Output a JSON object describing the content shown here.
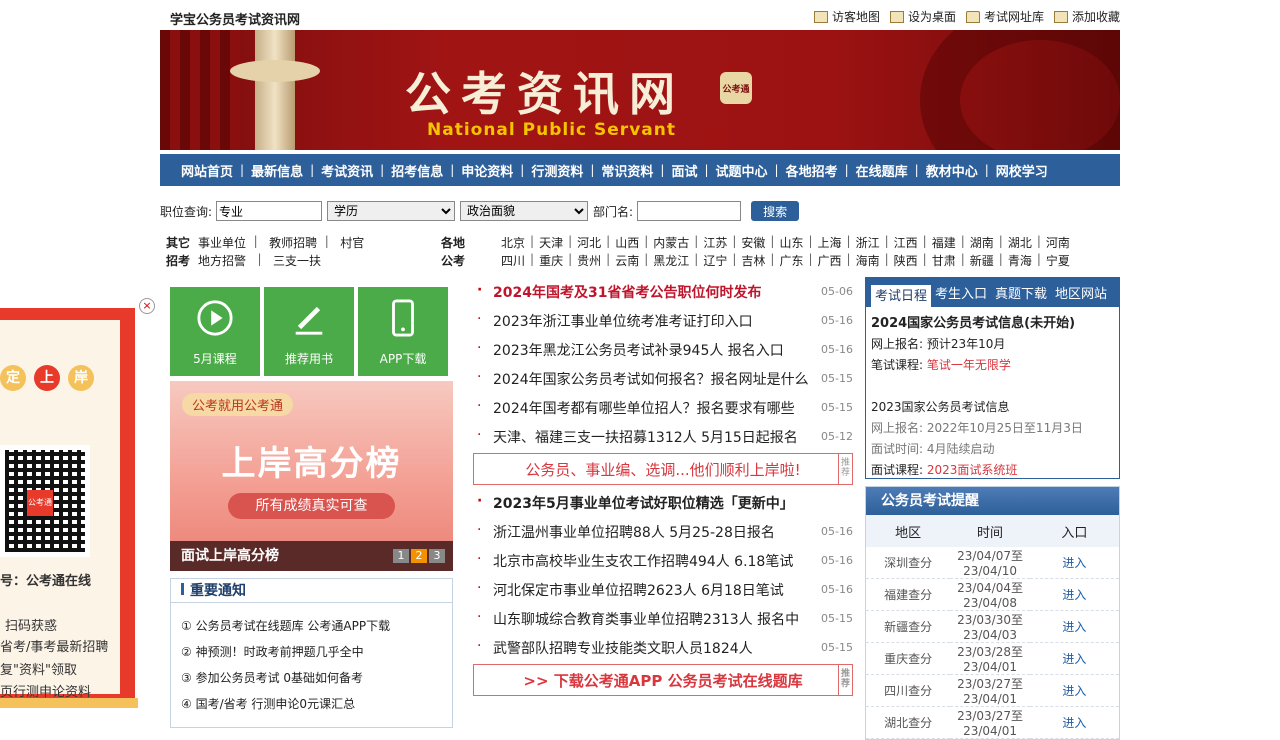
{
  "top": {
    "site_name": "学宝公务员考试资讯网",
    "links": [
      "访客地图",
      "设为桌面",
      "考试网址库",
      "添加收藏"
    ]
  },
  "banner": {
    "title": "公考资讯网",
    "badge": "公考通",
    "subtitle": "National Public Servant"
  },
  "nav": [
    "网站首页",
    "最新信息",
    "考试资讯",
    "招考信息",
    "申论资料",
    "行测资料",
    "常识资料",
    "面试",
    "试题中心",
    "各地招考",
    "在线题库",
    "教材中心",
    "网校学习"
  ],
  "search": {
    "label": "职位查询:",
    "major_value": "专业",
    "education": "学历",
    "politics": "政治面貌",
    "dept_label": "部门名:",
    "button": "搜索"
  },
  "regions": {
    "other_label_1": "其它",
    "other_label_2": "招考",
    "other_row1": [
      "事业单位",
      "教师招聘",
      "村官"
    ],
    "other_row2": [
      "地方招警",
      "三支一扶"
    ],
    "prov_label_1": "各地",
    "prov_label_2": "公考",
    "prov_row1": [
      "北京",
      "天津",
      "河北",
      "山西",
      "内蒙古",
      "江苏",
      "安徽",
      "山东",
      "上海",
      "浙江",
      "江西",
      "福建",
      "湖南",
      "湖北",
      "河南"
    ],
    "prov_row2": [
      "四川",
      "重庆",
      "贵州",
      "云南",
      "黑龙江",
      "辽宁",
      "吉林",
      "广东",
      "广西",
      "海南",
      "陕西",
      "甘肃",
      "新疆",
      "青海",
      "宁夏"
    ]
  },
  "tiles": [
    "5月课程",
    "推荐用书",
    "APP下载"
  ],
  "promo": {
    "tag": "公考就用公考通",
    "big": "上岸高分榜",
    "sub": "所有成绩真实可查",
    "caption": "面试上岸高分榜",
    "pages": [
      "1",
      "2",
      "3"
    ]
  },
  "notice": {
    "title": "重要通知",
    "items": [
      "① 公务员考试在线题库 公考通APP下载",
      "② 神预测！时政考前押题几乎全中",
      "③ 参加公务员考试 0基础如何备考",
      "④ 国考/省考 行测申论0元课汇总"
    ]
  },
  "news": {
    "group1": [
      {
        "title": "2024年国考及31省省考公告职位何时发布",
        "date": "05-06"
      },
      {
        "title": "2023年浙江事业单位统考准考证打印入口",
        "date": "05-16"
      },
      {
        "title": "2023年黑龙江公务员考试补录945人 报名入口",
        "date": "05-16"
      },
      {
        "title": "2024年国家公务员考试如何报名？报名网址是什么",
        "date": "05-15"
      },
      {
        "title": "2024年国考都有哪些单位招人？报名要求有哪些",
        "date": "05-15"
      },
      {
        "title": "天津、福建三支一扶招募1312人 5月15日起报名",
        "date": "05-12"
      }
    ],
    "slogan1": "公务员、事业编、选调...他们顺利上岸啦!",
    "slogan_tag": "推荐",
    "headline": "2023年5月事业单位考试好职位精选「更新中」",
    "group2": [
      {
        "title": "浙江温州事业单位招聘88人 5月25-28日报名",
        "date": "05-16"
      },
      {
        "title": "北京市高校毕业生支农工作招聘494人 6.18笔试",
        "date": "05-16"
      },
      {
        "title": "河北保定市事业单位招聘2623人 6月18日笔试",
        "date": "05-16"
      },
      {
        "title": "山东聊城综合教育类事业单位招聘2313人 报名中",
        "date": "05-15"
      },
      {
        "title": "武警部队招聘专业技能类文职人员1824人",
        "date": "05-15"
      }
    ],
    "slogan2": ">> 下载公考通APP 公务员考试在线题库"
  },
  "right": {
    "tabs": [
      "考试日程",
      "考生入口",
      "真题下载",
      "地区网站"
    ],
    "exam": {
      "h1": "2024国家公务员考试信息(未开始)",
      "reg_label": "网上报名:",
      "reg_value": "预计23年10月",
      "course_label": "笔试课程:",
      "course_value": "笔试一年无限学",
      "h2": "2023国家公务员考试信息",
      "reg2": "网上报名: 2022年10月25日至11月3日",
      "interview": "面试时间: 4月陆续启动",
      "course2_label": "面试课程:",
      "course2_value": "2023面试系统班"
    },
    "remind": {
      "title": "公务员考试提醒",
      "cols": [
        "地区",
        "时间",
        "入口"
      ],
      "rows": [
        {
          "area": "深圳查分",
          "time": "23/04/07至23/04/10",
          "go": "进入"
        },
        {
          "area": "福建查分",
          "time": "23/04/04至23/04/08",
          "go": "进入"
        },
        {
          "area": "新疆查分",
          "time": "23/03/30至23/04/03",
          "go": "进入"
        },
        {
          "area": "重庆查分",
          "time": "23/03/28至23/04/01",
          "go": "进入"
        },
        {
          "area": "四川查分",
          "time": "23/03/27至23/04/01",
          "go": "进入"
        },
        {
          "area": "湖北查分",
          "time": "23/03/27至23/04/01",
          "go": "进入"
        }
      ]
    }
  },
  "float_ad": {
    "circles": [
      "定",
      "上",
      "岸"
    ],
    "qr_logo": "公考通",
    "line1": "号：公考通在线",
    "line2": "扫码获惑",
    "line3": "省考/事考最新招聘",
    "line4": "复\"资料\"领取",
    "line5": "页行测申论资料",
    "close": "×"
  },
  "colors": {
    "nav": "#2d5f9a",
    "banner": "#9c1212",
    "tile": "#4bab48",
    "hot": "#c0142c"
  }
}
